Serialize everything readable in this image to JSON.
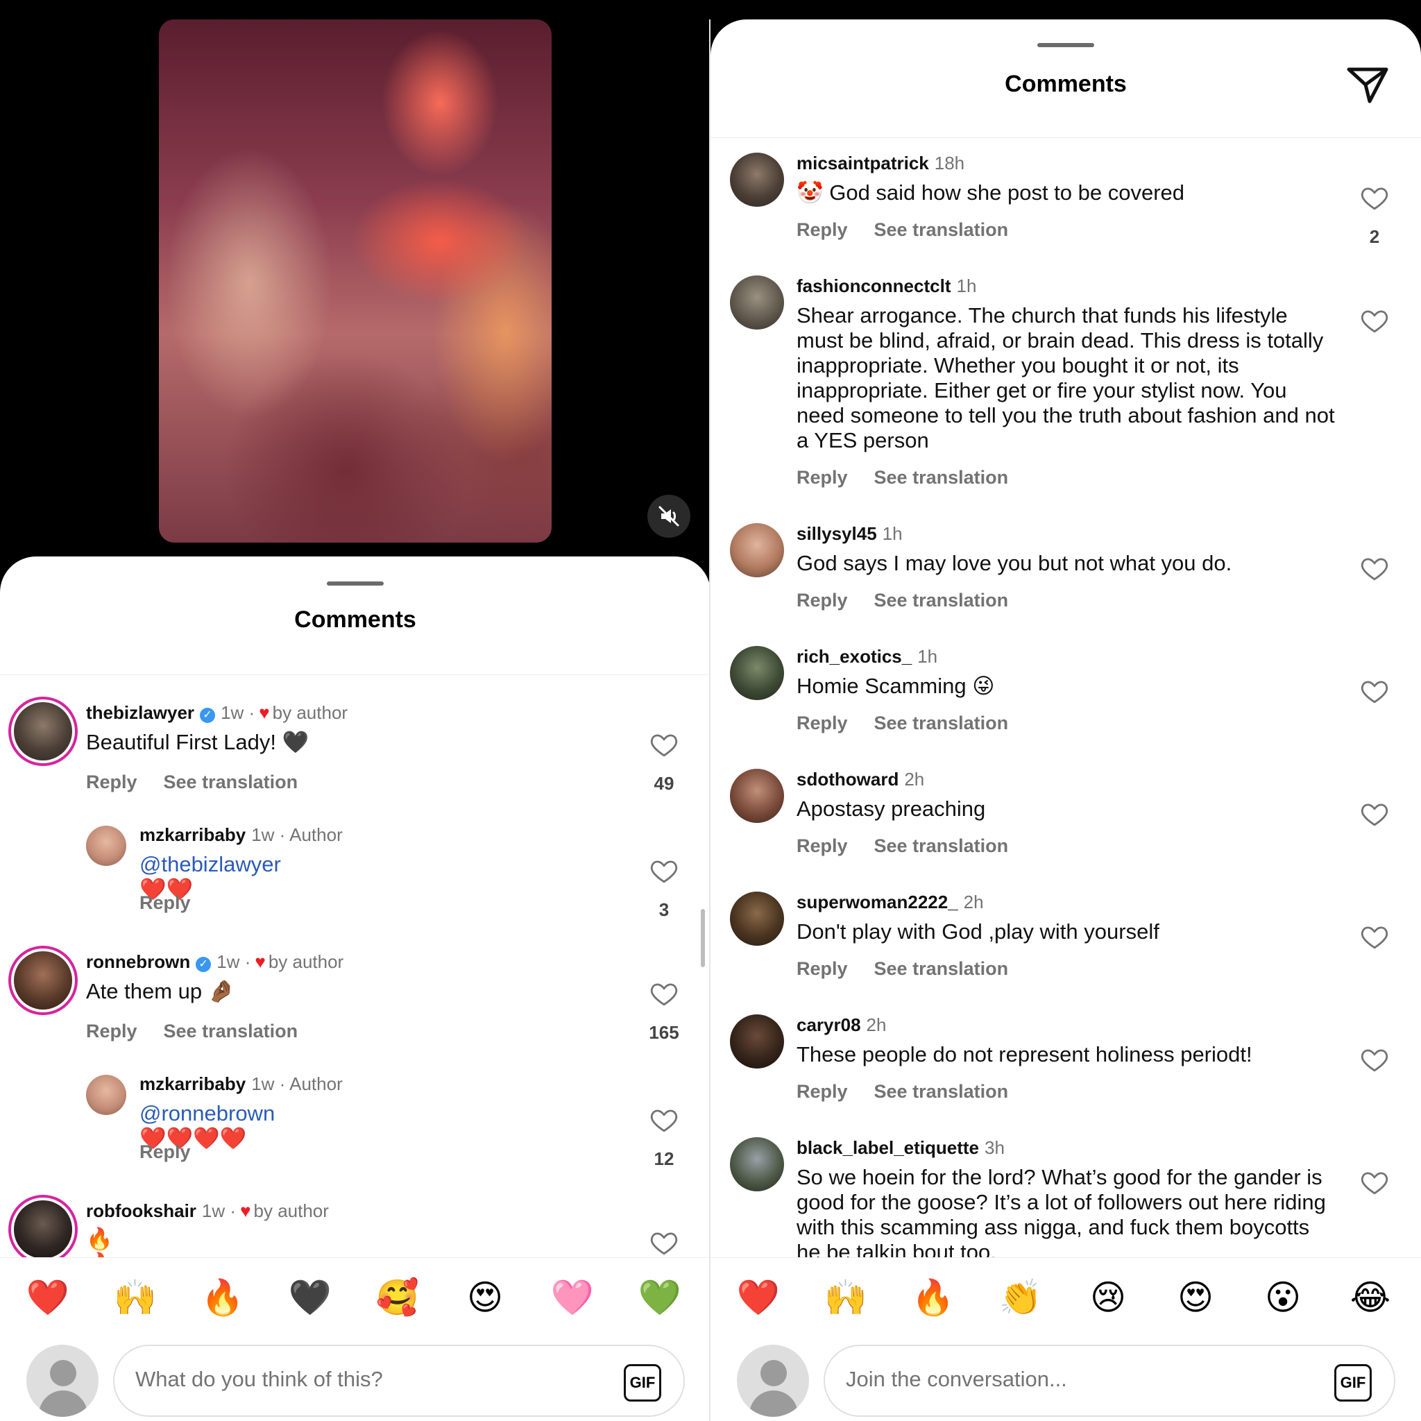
{
  "left_panel": {
    "title": "Comments",
    "comments": [
      {
        "user": "thebizlawyer",
        "verified": true,
        "time": "1w",
        "separator": "·",
        "author_like": "by author",
        "text": "Beautiful First Lady! 🖤",
        "reply": "Reply",
        "translate": "See translation",
        "likes": "49"
      },
      {
        "user": "mzkarribaby",
        "time": "1w",
        "tag": "· Author",
        "mention": "@thebizlawyer",
        "emojis": "❤️❤️",
        "reply": "Reply",
        "likes": "3"
      },
      {
        "user": "ronnebrown",
        "verified": true,
        "time": "1w",
        "separator": "·",
        "author_like": "by author",
        "text": "Ate them up 🤌🏾",
        "reply": "Reply",
        "translate": "See translation",
        "likes": "165"
      },
      {
        "user": "mzkarribaby",
        "time": "1w",
        "tag": "· Author",
        "mention": "@ronnebrown",
        "emojis": "❤️❤️❤️❤️",
        "reply": "Reply",
        "likes": "12"
      },
      {
        "user": "robfookshair",
        "time": "1w",
        "separator": "·",
        "author_like": "by author",
        "text": "🔥🔥🔥"
      }
    ],
    "emoji_bar": [
      "❤️",
      "🙌",
      "🔥",
      "🖤",
      "🥰",
      "😍",
      "🩷",
      "💚"
    ],
    "input_placeholder": "What do you think of this?",
    "gif_label": "GIF"
  },
  "right_panel": {
    "title": "Comments",
    "comments": [
      {
        "user": "micsaintpatrick",
        "time": "18h",
        "text": "🤡 God said how she post to be covered",
        "reply": "Reply",
        "translate": "See translation",
        "likes": "2"
      },
      {
        "user": "fashionconnectclt",
        "time": "1h",
        "text": "Shear arrogance. The church that funds his lifestyle must be blind, afraid, or brain dead. This dress is totally inappropriate. Whether you bought it or not, its inappropriate. Either get or fire your stylist now. You need someone to tell you the truth about fashion and not a YES person",
        "reply": "Reply",
        "translate": "See translation"
      },
      {
        "user": "sillysyl45",
        "time": "1h",
        "text": "God says I may love you but not what you do.",
        "reply": "Reply",
        "translate": "See translation"
      },
      {
        "user": "rich_exotics_",
        "time": "1h",
        "text": "Homie Scamming 😜",
        "reply": "Reply",
        "translate": "See translation"
      },
      {
        "user": "sdothoward",
        "time": "2h",
        "text": "Apostasy preaching",
        "reply": "Reply",
        "translate": "See translation"
      },
      {
        "user": "superwoman2222_",
        "time": "2h",
        "text": "Don't play with God ,play with yourself",
        "reply": "Reply",
        "translate": "See translation"
      },
      {
        "user": "caryr08",
        "time": "2h",
        "text": "These people do not represent holiness periodt!",
        "reply": "Reply",
        "translate": "See translation"
      },
      {
        "user": "black_label_etiquette",
        "time": "3h",
        "text": "So we hoein for the lord? What’s good for the gander is good for the goose? It’s a lot of followers out here riding with this scamming ass nigga, and fuck them boycotts he be talkin bout too."
      }
    ],
    "emoji_bar": [
      "❤️",
      "🙌",
      "🔥",
      "👏",
      "😢",
      "😍",
      "😮",
      "😂"
    ],
    "input_placeholder": "Join the conversation...",
    "gif_label": "GIF"
  },
  "icons": {
    "mute": "speaker-muted-icon",
    "share": "paper-plane-icon",
    "like": "heart-outline-icon",
    "verified": "verified-badge-icon"
  },
  "colors": {
    "mention": "#2b5bb8",
    "verified": "#3897f0",
    "author_heart": "#ed1d24",
    "meta_text": "#737373"
  }
}
